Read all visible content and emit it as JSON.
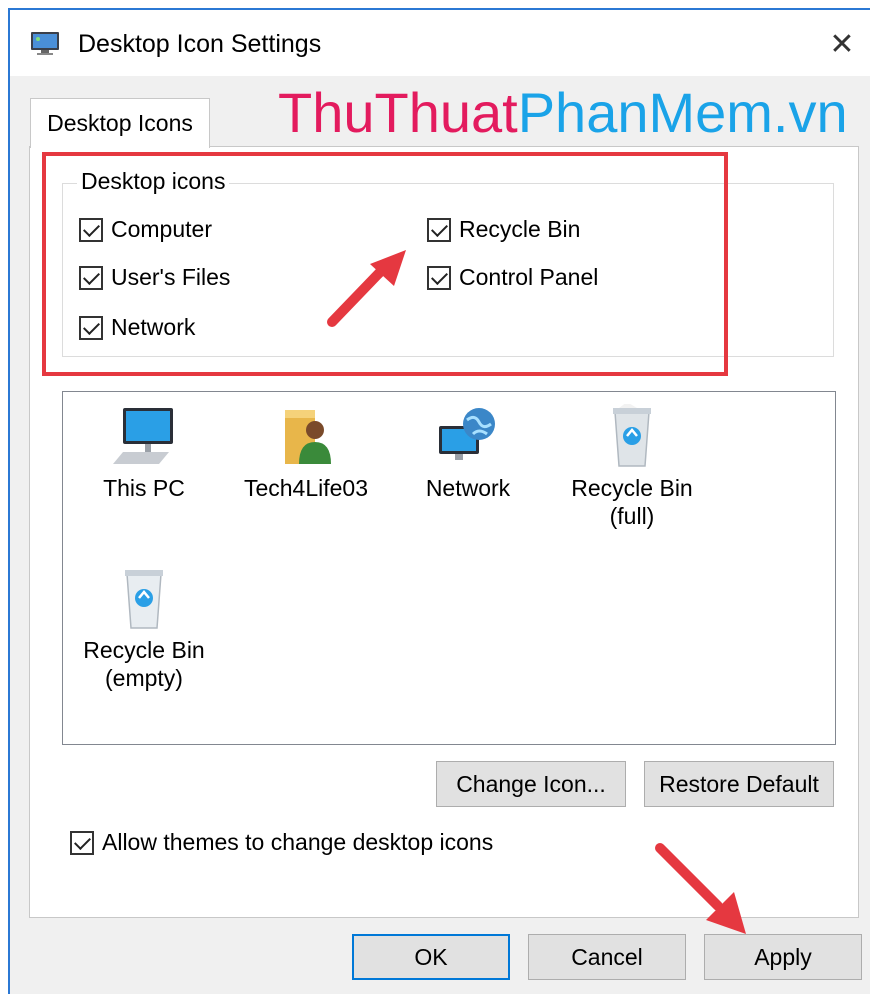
{
  "window": {
    "title": "Desktop Icon Settings",
    "watermark_part1": "ThuThuat",
    "watermark_part2": "PhanMem.vn"
  },
  "tabs": [
    {
      "label": "Desktop Icons",
      "active": true
    }
  ],
  "desktop_icons_group": {
    "label": "Desktop icons",
    "checkboxes": [
      {
        "label": "Computer",
        "checked": true
      },
      {
        "label": "User's Files",
        "checked": true
      },
      {
        "label": "Network",
        "checked": true
      },
      {
        "label": "Recycle Bin",
        "checked": true
      },
      {
        "label": "Control Panel",
        "checked": true
      }
    ]
  },
  "icon_list": {
    "items": [
      {
        "line1": "This PC",
        "line2": "",
        "icon": "computer-icon"
      },
      {
        "line1": "Tech4Life03",
        "line2": "",
        "icon": "user-folder-icon"
      },
      {
        "line1": "Network",
        "line2": "",
        "icon": "network-globe-icon"
      },
      {
        "line1": "Recycle Bin",
        "line2": "(full)",
        "icon": "recycle-bin-full-icon"
      },
      {
        "line1": "Recycle Bin",
        "line2": "(empty)",
        "icon": "recycle-bin-empty-icon"
      }
    ]
  },
  "buttons": {
    "change_icon": "Change Icon...",
    "restore_default": "Restore Default",
    "ok": "OK",
    "cancel": "Cancel",
    "apply": "Apply"
  },
  "allow_themes": {
    "label": "Allow themes to change desktop icons",
    "checked": true
  },
  "colors": {
    "highlight": "#e53840",
    "accent": "#0078d7",
    "watermark_pink": "#e31b5e",
    "watermark_blue": "#1aa3e8"
  }
}
